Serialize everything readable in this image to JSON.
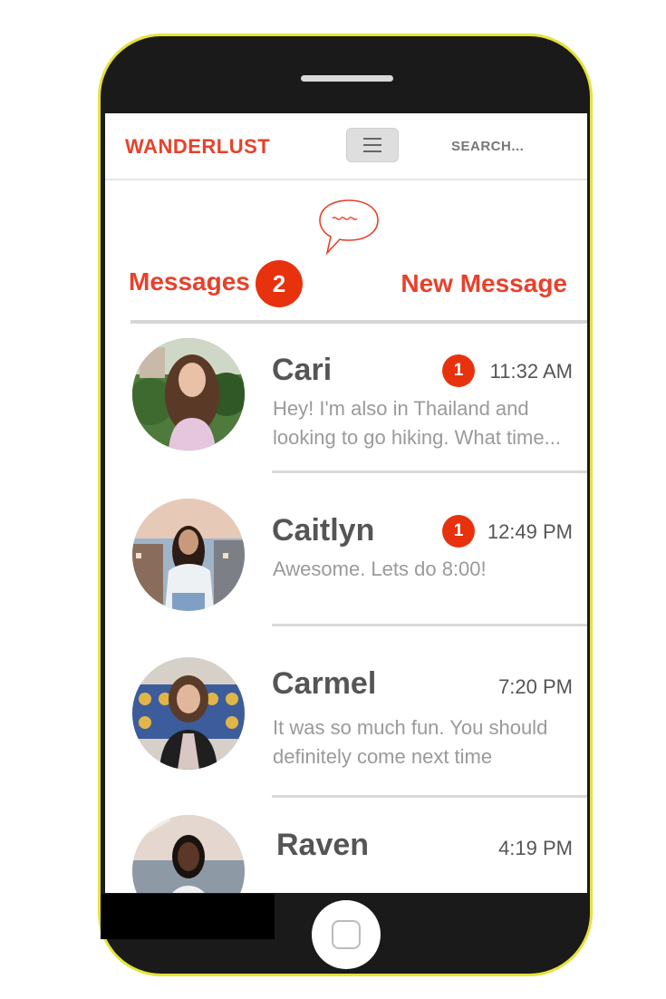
{
  "app": {
    "brand": "WANDERLUST",
    "search_label": "SEARCH...",
    "accent_color": "#e8412b",
    "badge_color": "#e8320e"
  },
  "messages": {
    "title": "Messages",
    "count": "2",
    "new_message_label": "New Message",
    "icon": "chat-bubble-icon"
  },
  "conversations": [
    {
      "name": "Cari",
      "time": "11:32 AM",
      "unread": "1",
      "preview": "Hey! I'm also in Thailand and looking to go hiking. What time..."
    },
    {
      "name": "Caitlyn",
      "time": "12:49 PM",
      "unread": "1",
      "preview": "Awesome. Lets do 8:00!"
    },
    {
      "name": "Carmel",
      "time": "7:20 PM",
      "unread": "",
      "preview": "It was so much fun. You should definitely come next time"
    },
    {
      "name": "Raven",
      "time": "4:19 PM",
      "unread": "",
      "preview": ""
    }
  ]
}
